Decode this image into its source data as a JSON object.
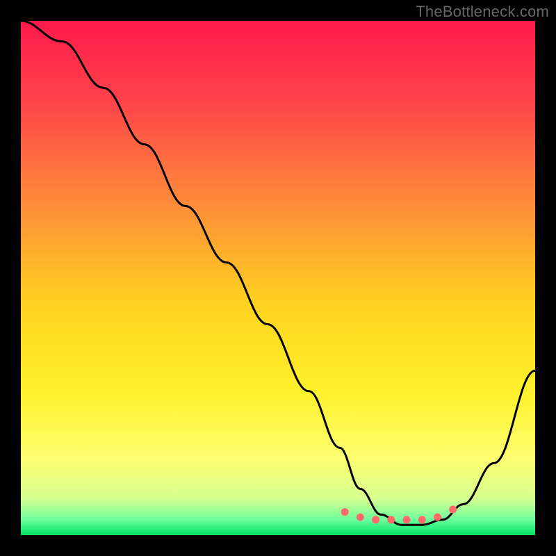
{
  "watermark": "TheBottleneck.com",
  "chart_data": {
    "type": "line",
    "title": "",
    "xlabel": "",
    "ylabel": "",
    "xlim": [
      0,
      100
    ],
    "ylim": [
      0,
      100
    ],
    "grid": false,
    "legend": false,
    "gradient_stops": [
      {
        "offset": 0.0,
        "color": "#ff1a4a"
      },
      {
        "offset": 0.15,
        "color": "#ff414a"
      },
      {
        "offset": 0.35,
        "color": "#ff8a3a"
      },
      {
        "offset": 0.55,
        "color": "#ffd21f"
      },
      {
        "offset": 0.72,
        "color": "#fff12a"
      },
      {
        "offset": 0.85,
        "color": "#fdff70"
      },
      {
        "offset": 0.93,
        "color": "#d5ff90"
      },
      {
        "offset": 0.97,
        "color": "#6cff9c"
      },
      {
        "offset": 1.0,
        "color": "#00e264"
      }
    ],
    "series": [
      {
        "name": "bottleneck-curve",
        "x": [
          0,
          8,
          16,
          24,
          32,
          40,
          48,
          56,
          62,
          66,
          70,
          74,
          78,
          82,
          86,
          92,
          100
        ],
        "y": [
          100,
          96,
          87,
          76,
          64,
          53,
          41,
          28,
          17,
          9,
          4,
          2,
          2,
          3,
          6,
          14,
          32
        ]
      }
    ],
    "markers": {
      "name": "optimal-range-dots",
      "color": "#ff6a6a",
      "x": [
        63,
        66,
        69,
        72,
        75,
        78,
        81,
        84
      ],
      "y": [
        4.5,
        3.5,
        3.0,
        3.0,
        3.0,
        3.0,
        3.5,
        5.0
      ]
    }
  }
}
